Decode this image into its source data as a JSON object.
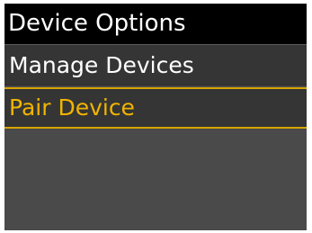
{
  "header": {
    "title": "Device Options"
  },
  "menu": {
    "items": [
      {
        "label": "Manage Devices",
        "selected": false
      },
      {
        "label": "Pair Device",
        "selected": true
      }
    ]
  },
  "colors": {
    "header_background": "#000000",
    "header_text": "#ffffff",
    "menu_background": "#353535",
    "menu_text": "#ffffff",
    "selected_text": "#f0b400",
    "selected_border": "#d7a500",
    "screen_background": "#4a4a4a"
  }
}
